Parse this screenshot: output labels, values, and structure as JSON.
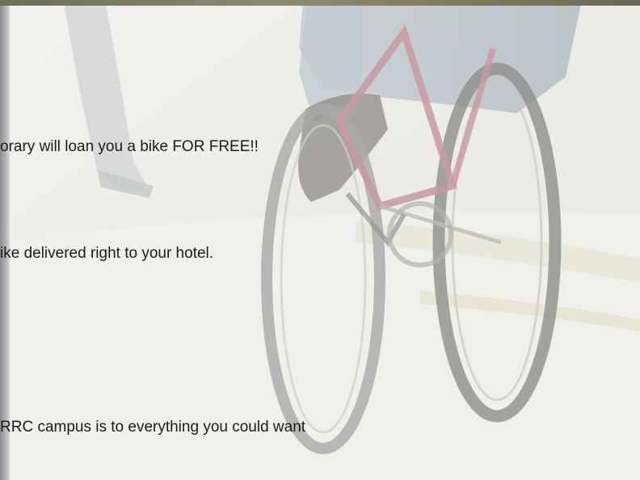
{
  "slide": {
    "lines": [
      "orary will loan you a bike FOR FREE!!",
      "ike delivered right to your hotel.",
      "RRC campus is to everything you could want"
    ]
  }
}
